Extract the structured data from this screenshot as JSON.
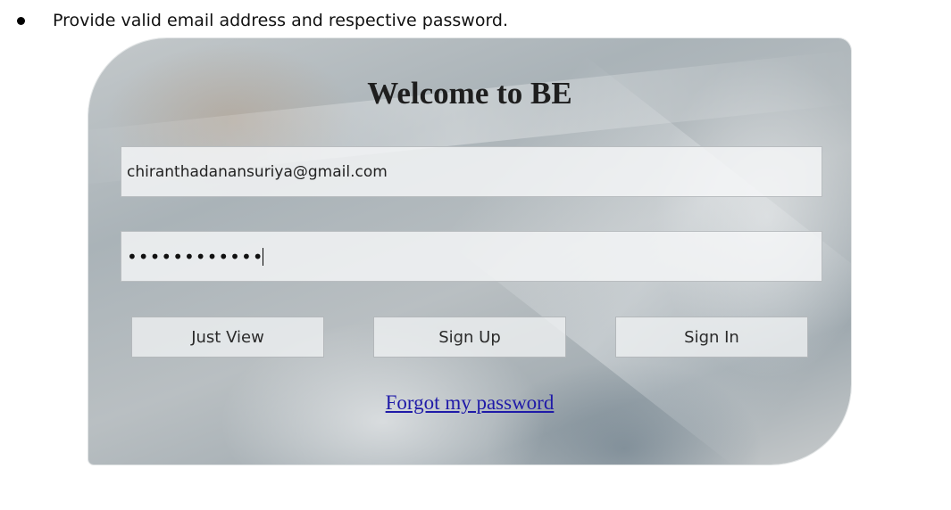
{
  "instruction": {
    "text": "Provide valid email address and respective password."
  },
  "login": {
    "title": "Welcome to BE",
    "email_value": "chiranthadanansuriya@gmail.com",
    "password_masked": "••••••••••••",
    "buttons": {
      "just_view": "Just View",
      "sign_up": "Sign Up",
      "sign_in": "Sign In"
    },
    "forgot_link": "Forgot my password"
  }
}
